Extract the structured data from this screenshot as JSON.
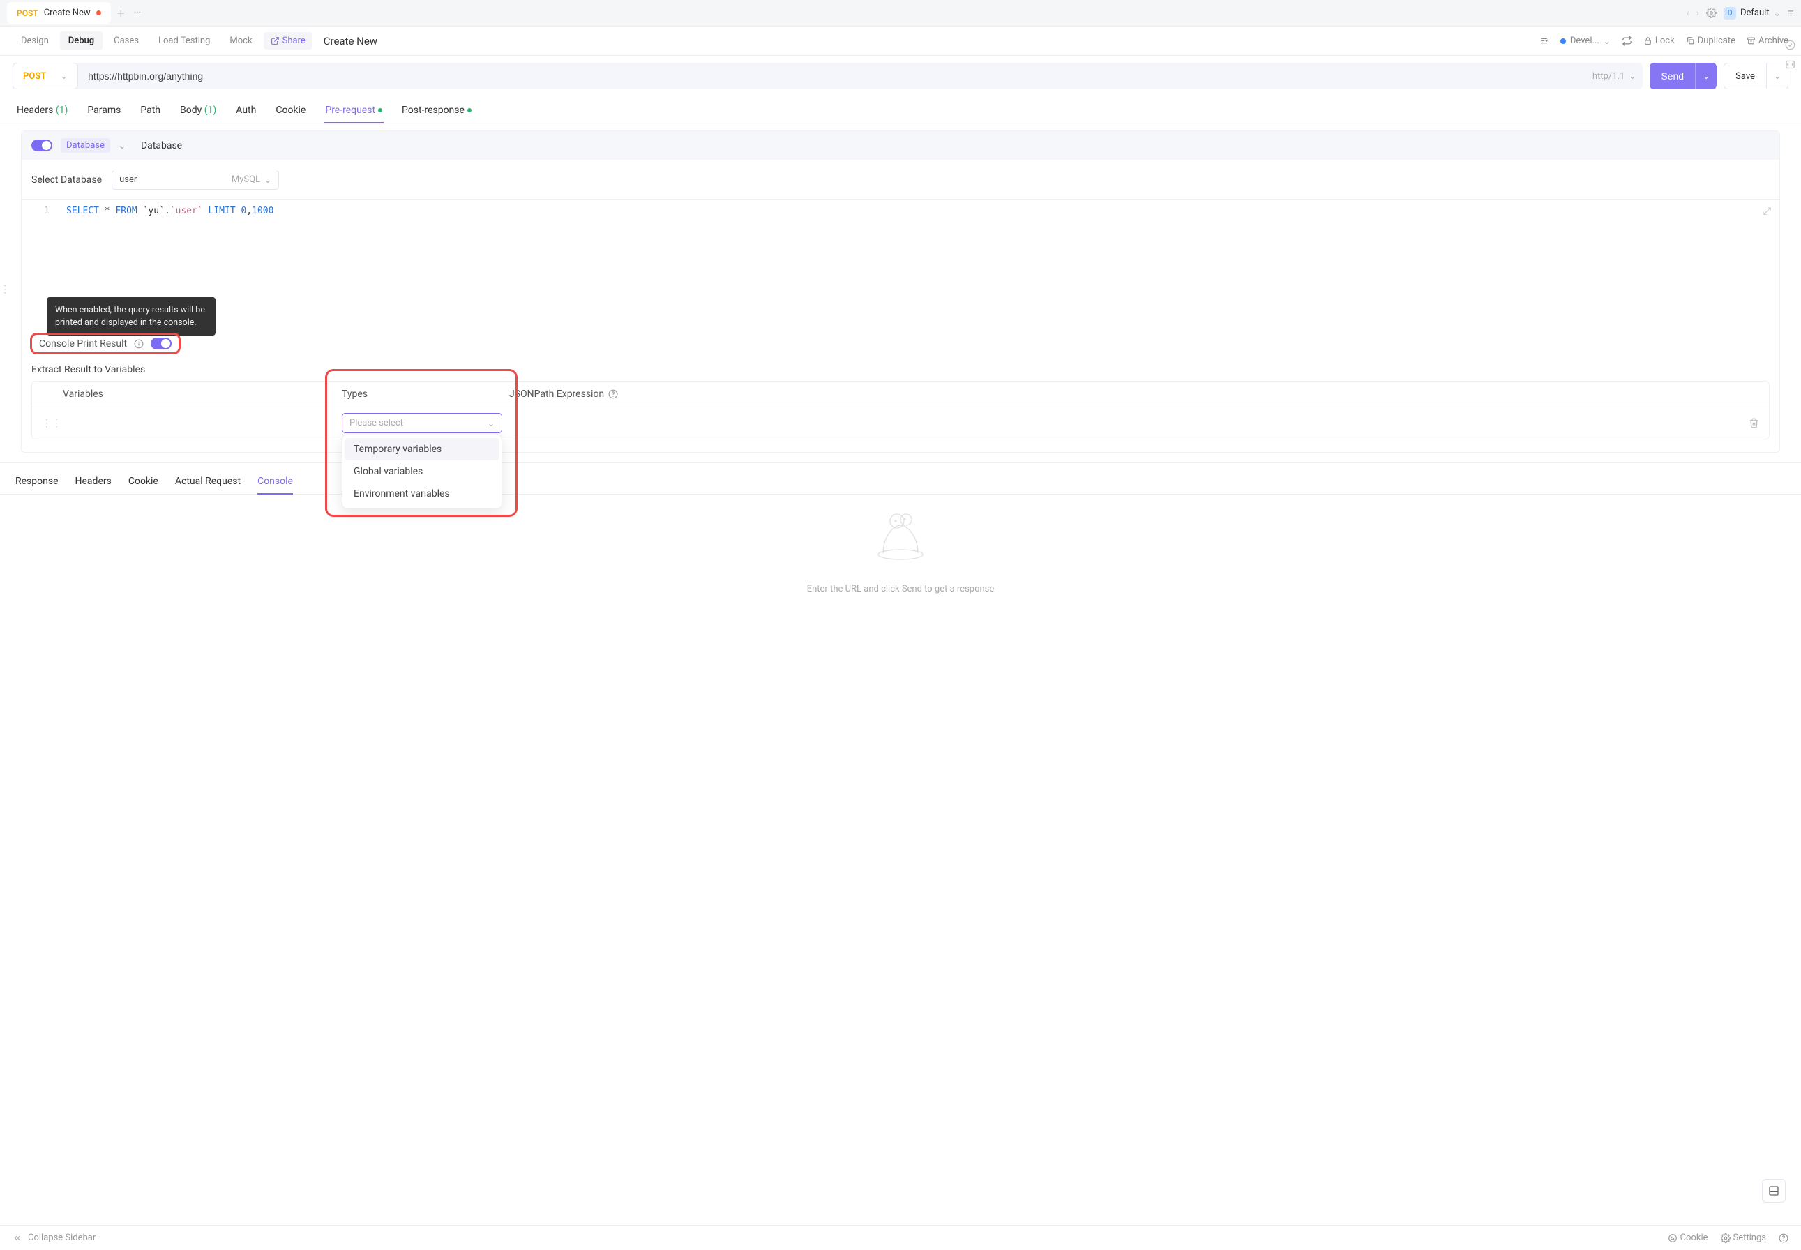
{
  "topbar": {
    "tab_method": "POST",
    "tab_title": "Create New",
    "env_label": "Default",
    "env_badge": "D"
  },
  "subbar": {
    "tabs": {
      "design": "Design",
      "debug": "Debug",
      "cases": "Cases",
      "load": "Load Testing",
      "mock": "Mock"
    },
    "share": "Share",
    "title": "Create New",
    "dev_env": "Devel...",
    "lock": "Lock",
    "duplicate": "Duplicate",
    "archive": "Archive"
  },
  "url": {
    "method": "POST",
    "input": "https://httpbin.org/anything",
    "proto": "http/1.1",
    "send": "Send",
    "save": "Save"
  },
  "reqtabs": {
    "headers": "Headers",
    "headers_n": "(1)",
    "params": "Params",
    "path": "Path",
    "body": "Body",
    "body_n": "(1)",
    "auth": "Auth",
    "cookie": "Cookie",
    "pre": "Pre-request",
    "post": "Post-response"
  },
  "prereq": {
    "db_chip": "Database",
    "panel_title": "Database",
    "select_db_label": "Select Database",
    "db_name": "user",
    "db_type": "MySQL",
    "sql_raw": "SELECT * FROM `yu`.`user` LIMIT 0,1000",
    "line_no": "1",
    "tooltip": "When enabled, the query results will be printed and displayed in the console.",
    "console_print": "Console Print Result",
    "extract_label": "Extract Result to Variables",
    "col_var": "Variables",
    "col_type": "Types",
    "col_json": "JSONPath Expression",
    "type_ph": "Please select",
    "opts": {
      "temp": "Temporary variables",
      "global": "Global variables",
      "env": "Environment variables"
    }
  },
  "bottom": {
    "response": "Response",
    "headers": "Headers",
    "cookie": "Cookie",
    "actual": "Actual Request",
    "console": "Console",
    "empty": "Enter the URL and click Send to get a response"
  },
  "status": {
    "collapse": "Collapse Sidebar",
    "cookie": "Cookie",
    "settings": "Settings"
  }
}
